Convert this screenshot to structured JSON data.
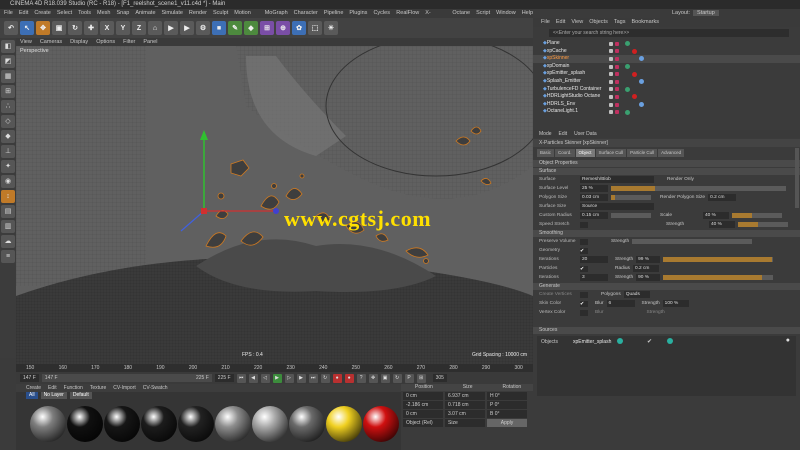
{
  "window": {
    "title": "CINEMA 4D R18.039 Studio (RC - R18) - [F1_reelshot_scene1_v11.c4d *] - Main"
  },
  "menus": [
    "File",
    "Edit",
    "Create",
    "Select",
    "Tools",
    "Mesh",
    "Snap",
    "Animate",
    "Simulate",
    "Render",
    "Sculpt",
    "Motion Tracker",
    "MoGraph",
    "Character",
    "Pipeline",
    "Plugins",
    "Cycles 4D",
    "RealFlow",
    "X-Particles",
    "Octane",
    "Script",
    "Window",
    "Help"
  ],
  "layout": {
    "label": "Layout:",
    "value": "Startup"
  },
  "viewport": {
    "menus": [
      "View",
      "Cameras",
      "Display",
      "Options",
      "Filter",
      "Panel"
    ],
    "label": "Perspective",
    "fps": "FPS : 0.4",
    "grid": "Grid Spacing : 10000 cm"
  },
  "watermark": "www.cgtsj.com",
  "ruler": [
    "150",
    "160",
    "170",
    "180",
    "190",
    "200",
    "210",
    "220",
    "230",
    "240",
    "250",
    "260",
    "270",
    "280",
    "290",
    "300"
  ],
  "timeline": {
    "start": "147 F",
    "current": "147 F",
    "end": "225 F",
    "end2": "225 F",
    "field2": "305 F",
    "frame": "305"
  },
  "materials": {
    "tabs": [
      "Create",
      "Edit",
      "Function",
      "Texture",
      "CV-Import",
      "CV-Swatch"
    ],
    "filters": [
      "All",
      "No Layer",
      "Default"
    ],
    "balls": [
      "#7e7e7e",
      "#101010",
      "#161616",
      "#1c1c1c",
      "#222",
      "#8e8e8e",
      "#aaa",
      "#6a6a6a",
      "#f0d020",
      "#d01010"
    ]
  },
  "coords": {
    "headers": [
      "Position",
      "Size",
      "Rotation"
    ],
    "rows": [
      [
        "0 cm",
        "6.937 cm",
        "H 0°"
      ],
      [
        "-2.186 cm",
        "0.718 cm",
        "P 0°"
      ],
      [
        "0 cm",
        "3.07 cm",
        "B 0°"
      ]
    ],
    "mode": "Object (Rel)",
    "sizemode": "Size",
    "apply": "Apply"
  },
  "objmanager": {
    "menus": [
      "File",
      "Edit",
      "View",
      "Objects",
      "Tags",
      "Bookmarks"
    ],
    "search": "<<Enter your search string here>>",
    "objects": [
      {
        "name": "Plane",
        "sel": false
      },
      {
        "name": "xpCache",
        "sel": false
      },
      {
        "name": "xpSkinner",
        "sel": true
      },
      {
        "name": "xpDomain",
        "sel": false
      },
      {
        "name": "xpEmitter_splash",
        "sel": false
      },
      {
        "name": "Splash_Emitter",
        "sel": false
      },
      {
        "name": "TurbulenceFD Container",
        "sel": false
      },
      {
        "name": "HDRLightStudio Octane",
        "sel": false
      },
      {
        "name": "HDRLS_Env",
        "sel": false
      },
      {
        "name": "OctaneLight.1",
        "sel": false
      }
    ]
  },
  "attrs": {
    "menus": [
      "Mode",
      "Edit",
      "User Data"
    ],
    "title": "X-Particles Skinner [xpSkinner]",
    "tabs": [
      "Basic",
      "Coord.",
      "Object",
      "Surface Cull",
      "Particle Cull",
      "Advanced"
    ],
    "active_tab": "Object",
    "section_title": "Object Properties",
    "surface": {
      "head": "Surface",
      "surface_lbl": "Surface",
      "surface_val": "Remesh/Blob",
      "render_only": "Render Only",
      "level_lbl": "Surface Level",
      "level_val": "25 %",
      "level_fill": 0.25,
      "poly_lbl": "Polygon Size",
      "poly_val": "0.03 cm",
      "render_poly_lbl": "Render Polygon Size",
      "render_poly_val": "0.2 cm",
      "size_lbl": "Surface Size",
      "size_val": "Source",
      "radius_lbl": "Custom Radius",
      "radius_val": "0.15 cm",
      "scale_lbl": "Scale",
      "scale_val": "40 %",
      "scale_fill": 0.4,
      "stretch_lbl": "Speed Stretch",
      "strength_lbl": "Strength",
      "strength_val": "40 %",
      "strength_fill": 0.4
    },
    "smoothing": {
      "head": "Smoothing",
      "preserve": "Preserve Volume",
      "strength_lbl": "Strength",
      "geometry": "Geometry",
      "iter_lbl": "Iterations",
      "iter_val": "20",
      "gstr_lbl": "Strength",
      "gstr_val": "99 %",
      "gstr_fill": 0.99,
      "particles": "Particles",
      "radius_lbl": "Radius",
      "radius_val": "0.2 cm",
      "piter_lbl": "Iterations",
      "piter_val": "3",
      "pstr_lbl": "Strength",
      "pstr_val": "90 %",
      "pstr_fill": 0.9
    },
    "generate": {
      "head": "Generate",
      "create_lbl": "Create Vertices",
      "poly_lbl": "Polygons",
      "poly_val": "Quads",
      "skin_lbl": "Skin Color",
      "blur_lbl": "Blur",
      "blur_val": "6",
      "bstr_lbl": "Strength",
      "bstr_val": "100 %",
      "vert_lbl": "Vertex Color",
      "vblur_lbl": "Blur",
      "vstr_lbl": "Strength"
    },
    "sources": {
      "head": "Sources",
      "objects_lbl": "Objects",
      "item": "xpEmitter_splash"
    }
  }
}
